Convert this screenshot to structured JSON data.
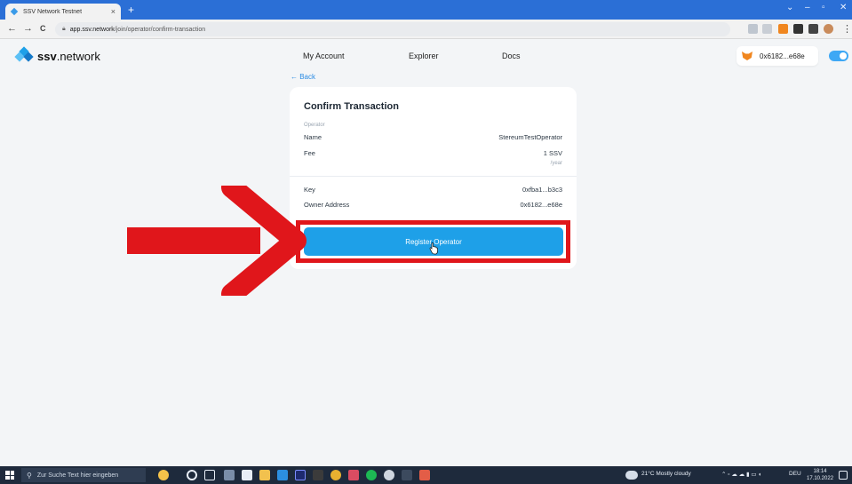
{
  "browser": {
    "tab_title": "SSV Network Testnet",
    "tab_close": "×",
    "new_tab": "+",
    "url_domain": "app.ssv.network",
    "url_path": "/join/operator/confirm-transaction",
    "back": "←",
    "forward": "→",
    "reload": "C"
  },
  "app": {
    "brand_bold": "ssv",
    "brand_rest": ".network",
    "nav": [
      "My Account",
      "Explorer",
      "Docs"
    ],
    "wallet_address": "0x6182...e68e",
    "back_link": "← Back"
  },
  "card": {
    "title": "Confirm Transaction",
    "section_label": "Operator",
    "name_label": "Name",
    "name_value": "StereumTestOperator",
    "fee_label": "Fee",
    "fee_value": "1 SSV",
    "fee_unit": "/year",
    "key_label": "Key",
    "key_value": "0xfba1...b3c3",
    "owner_label": "Owner Address",
    "owner_value": "0x6182...e68e",
    "button_label": "Register Operator"
  },
  "colors": {
    "accent": "#1ea0e8",
    "highlight": "#e0161b",
    "tabbar": "#2b6fd6"
  },
  "taskbar": {
    "search_placeholder": "Zur Suche Text hier eingeben",
    "weather": "21°C  Mostly cloudy",
    "language": "DEU",
    "time": "18:14",
    "date": "17.10.2022"
  }
}
